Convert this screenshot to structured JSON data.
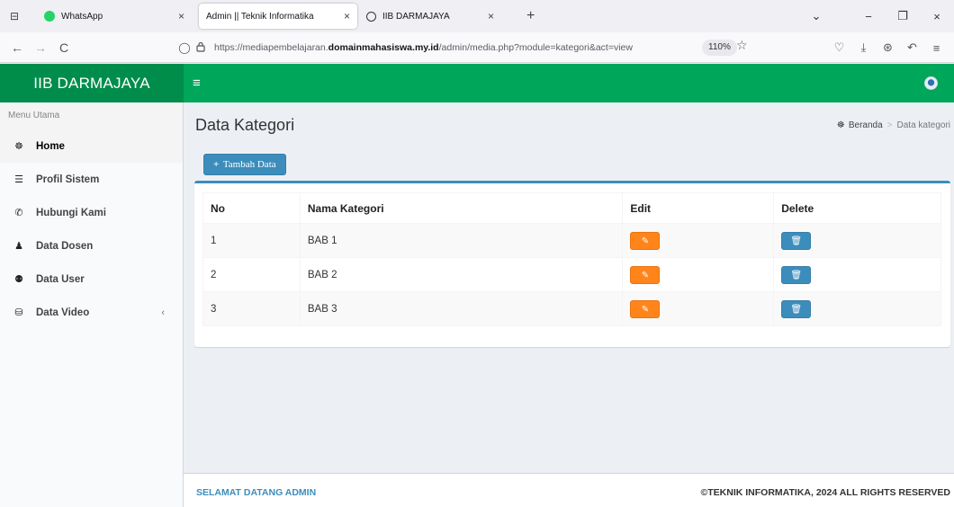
{
  "browser": {
    "tabs": [
      {
        "title": "WhatsApp",
        "close": "×"
      },
      {
        "title": "Admin || Teknik Informatika",
        "close": "×"
      },
      {
        "title": "IIB DARMAJAYA",
        "close": "×"
      }
    ],
    "new_tab": "+",
    "url_host_prefix": "https://mediapembelajaran.",
    "url_host_bold": "domainmahasiswa.my.id",
    "url_path": "/admin/media.php?module=kategori&act=view",
    "zoom": "110%",
    "icons": {
      "back": "←",
      "forward": "→",
      "reload": "C",
      "shield": "◯",
      "lock": "🔒︎",
      "star": "☆",
      "pocket": "♡",
      "download": "⤓",
      "account": "⊛",
      "extensions": "↶",
      "menu": "≡",
      "list_tabs": "⊟",
      "chevron": "⌄",
      "minimize": "−",
      "restore": "❐",
      "close": "×"
    }
  },
  "app": {
    "brand": "IIB DARMAJAYA",
    "menu_icon": "≡",
    "sidebar": {
      "header": "Menu Utama",
      "items": [
        {
          "label": "Home",
          "icon": "☸",
          "active": true
        },
        {
          "label": "Profil Sistem",
          "icon": "☰"
        },
        {
          "label": "Hubungi Kami",
          "icon": "✆"
        },
        {
          "label": "Data Dosen",
          "icon": "♟"
        },
        {
          "label": "Data User",
          "icon": "⚉"
        },
        {
          "label": "Data Video",
          "icon": "⛁",
          "chevron": "‹"
        }
      ]
    },
    "page": {
      "title": "Data Kategori",
      "breadcrumb": {
        "icon": "☸",
        "home": "Beranda",
        "separator": ">",
        "current": "Data kategori"
      },
      "add_button": {
        "icon": "+",
        "label": "Tambah Data"
      }
    },
    "table": {
      "headers": [
        "No",
        "Nama Kategori",
        "Edit",
        "Delete"
      ],
      "rows": [
        {
          "no": "1",
          "name": "BAB 1"
        },
        {
          "no": "2",
          "name": "BAB 2"
        },
        {
          "no": "3",
          "name": "BAB 3"
        }
      ],
      "edit_icon": "✎",
      "delete_icon": "🗑︎"
    },
    "footer": {
      "left": "SELAMAT DATANG ADMIN",
      "right": "©TEKNIK INFORMATIKA, 2024 ALL RIGHTS RESERVED"
    },
    "colors": {
      "brand_dark_green": "#008d4c",
      "header_green": "#00a65a",
      "primary_blue": "#3c8dbc",
      "edit_orange": "#ff851b"
    }
  }
}
